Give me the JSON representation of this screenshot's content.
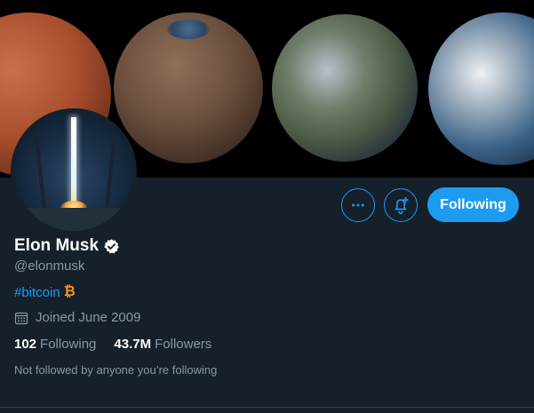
{
  "profile": {
    "name": "Elon Musk",
    "handle": "@elonmusk",
    "bio_hashtag": "#bitcoin",
    "bio_symbol": "₿",
    "joined": "Joined June 2009",
    "following_count": "102",
    "following_label": "Following",
    "followers_count": "43.7M",
    "followers_label": "Followers",
    "relationship_note": "Not followed by anyone you’re following"
  },
  "actions": {
    "more_icon": "more-horizontal-icon",
    "notify_icon": "bell-plus-icon",
    "follow_label": "Following"
  },
  "icons": {
    "verified": "verified-badge-icon",
    "calendar": "calendar-icon"
  },
  "colors": {
    "background": "#15202b",
    "accent": "#1d9bf0",
    "secondary_text": "#8899a6",
    "bitcoin": "#f7931a"
  }
}
